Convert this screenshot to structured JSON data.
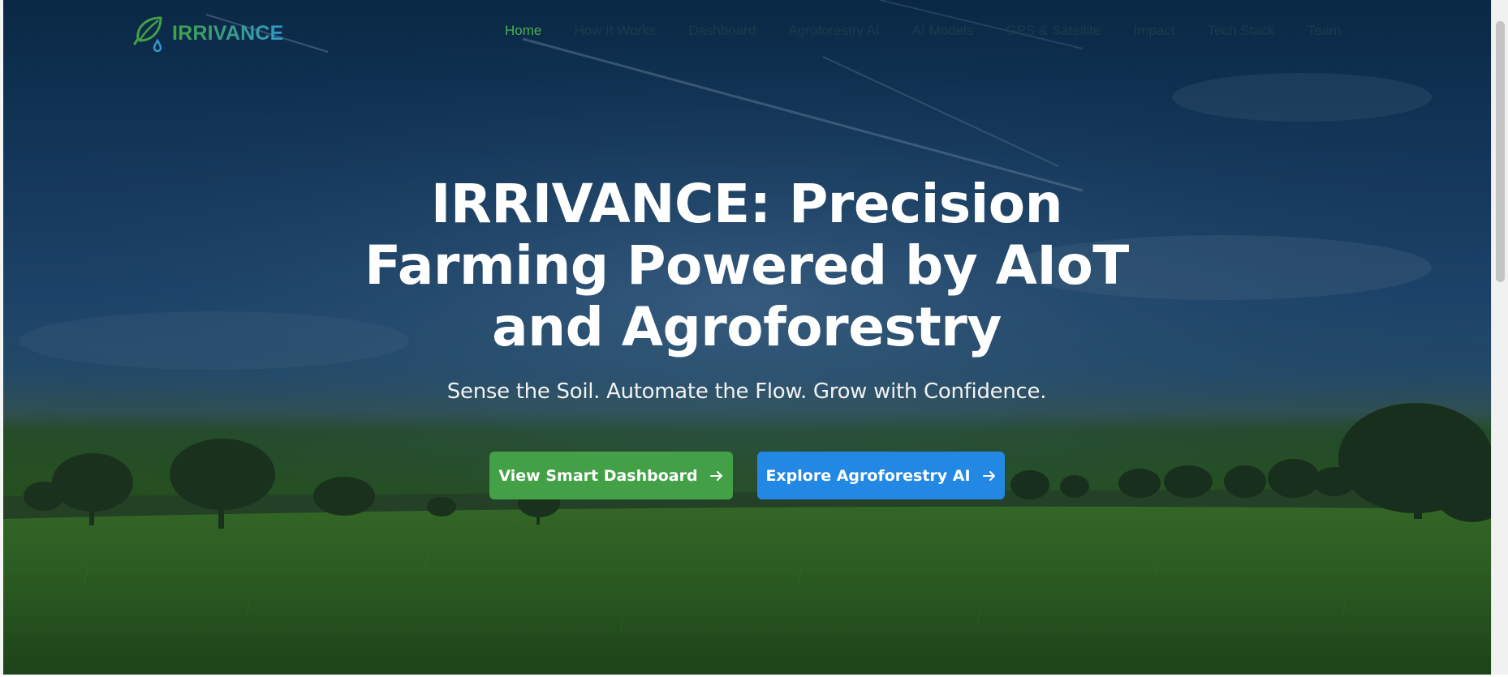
{
  "brand": {
    "name": "IRRIVANCE",
    "logo_icon": "leaf-droplet-icon"
  },
  "nav": {
    "items": [
      {
        "label": "Home",
        "active": true
      },
      {
        "label": "How It Works",
        "active": false
      },
      {
        "label": "Dashboard",
        "active": false
      },
      {
        "label": "Agroforestry AI",
        "active": false
      },
      {
        "label": "AI Models",
        "active": false
      },
      {
        "label": "GPS & Satellite",
        "active": false
      },
      {
        "label": "Impact",
        "active": false
      },
      {
        "label": "Tech Stack",
        "active": false
      },
      {
        "label": "Team",
        "active": false
      }
    ]
  },
  "hero": {
    "title_line_1": "IRRIVANCE: Precision",
    "title_line_2": "Farming Powered by AIoT",
    "title_line_3": "and Agroforestry",
    "subtitle": "Sense the Soil. Automate the Flow. Grow with Confidence.",
    "primary_button": {
      "label": "View Smart Dashboard",
      "icon": "arrow-right-icon"
    },
    "secondary_button": {
      "label": "Explore Agroforestry AI",
      "icon": "arrow-right-icon"
    }
  },
  "colors": {
    "brand_green": "#43a047",
    "nav_active": "#4caf50",
    "button_blue": "#2388e3",
    "hero_sky": "#173f66",
    "hero_field": "#2f5f23"
  }
}
